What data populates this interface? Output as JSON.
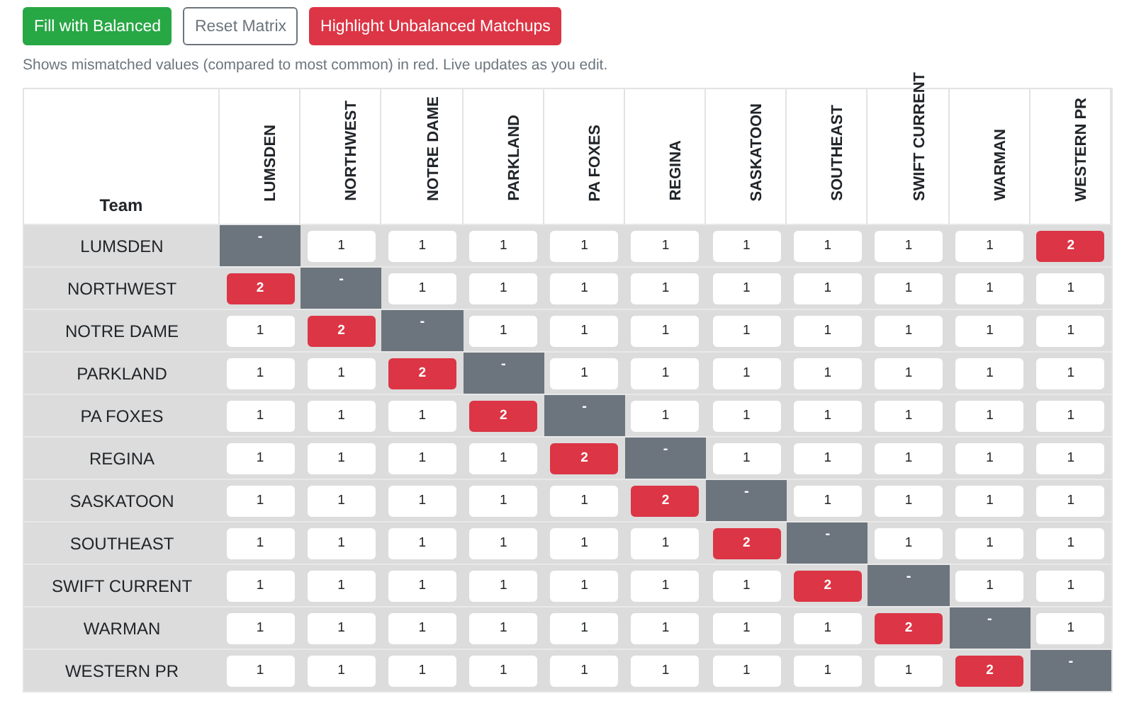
{
  "toolbar": {
    "buttons": [
      {
        "label": "Fill with Balanced",
        "kind": "success"
      },
      {
        "label": "Reset Matrix",
        "kind": "outline"
      },
      {
        "label": "Highlight Unbalanced Matchups",
        "kind": "danger"
      }
    ]
  },
  "caption": "Shows mismatched values (compared to most common) in red. Live updates as you edit.",
  "matrix": {
    "corner": "Team",
    "columns": [
      "LUMSDEN",
      "NORTHWEST",
      "NOTRE DAME",
      "PARKLAND",
      "PA FOXES",
      "REGINA",
      "SASKATOON",
      "SOUTHEAST",
      "SWIFT CURRENT",
      "WARMAN",
      "WESTERN PR"
    ],
    "rows": [
      {
        "team": "LUMSDEN",
        "cells": [
          {
            "kind": "self",
            "value": "-"
          },
          {
            "kind": "input",
            "value": "1",
            "mismatch": false
          },
          {
            "kind": "input",
            "value": "1",
            "mismatch": false
          },
          {
            "kind": "input",
            "value": "1",
            "mismatch": false
          },
          {
            "kind": "input",
            "value": "1",
            "mismatch": false
          },
          {
            "kind": "input",
            "value": "1",
            "mismatch": false
          },
          {
            "kind": "input",
            "value": "1",
            "mismatch": false
          },
          {
            "kind": "input",
            "value": "1",
            "mismatch": false
          },
          {
            "kind": "input",
            "value": "1",
            "mismatch": false
          },
          {
            "kind": "input",
            "value": "1",
            "mismatch": false
          },
          {
            "kind": "input",
            "value": "2",
            "mismatch": true
          }
        ]
      },
      {
        "team": "NORTHWEST",
        "cells": [
          {
            "kind": "input",
            "value": "2",
            "mismatch": true
          },
          {
            "kind": "self",
            "value": "-"
          },
          {
            "kind": "input",
            "value": "1",
            "mismatch": false
          },
          {
            "kind": "input",
            "value": "1",
            "mismatch": false
          },
          {
            "kind": "input",
            "value": "1",
            "mismatch": false
          },
          {
            "kind": "input",
            "value": "1",
            "mismatch": false
          },
          {
            "kind": "input",
            "value": "1",
            "mismatch": false
          },
          {
            "kind": "input",
            "value": "1",
            "mismatch": false
          },
          {
            "kind": "input",
            "value": "1",
            "mismatch": false
          },
          {
            "kind": "input",
            "value": "1",
            "mismatch": false
          },
          {
            "kind": "input",
            "value": "1",
            "mismatch": false
          }
        ]
      },
      {
        "team": "NOTRE DAME",
        "cells": [
          {
            "kind": "input",
            "value": "1",
            "mismatch": false
          },
          {
            "kind": "input",
            "value": "2",
            "mismatch": true
          },
          {
            "kind": "self",
            "value": "-"
          },
          {
            "kind": "input",
            "value": "1",
            "mismatch": false
          },
          {
            "kind": "input",
            "value": "1",
            "mismatch": false
          },
          {
            "kind": "input",
            "value": "1",
            "mismatch": false
          },
          {
            "kind": "input",
            "value": "1",
            "mismatch": false
          },
          {
            "kind": "input",
            "value": "1",
            "mismatch": false
          },
          {
            "kind": "input",
            "value": "1",
            "mismatch": false
          },
          {
            "kind": "input",
            "value": "1",
            "mismatch": false
          },
          {
            "kind": "input",
            "value": "1",
            "mismatch": false
          }
        ]
      },
      {
        "team": "PARKLAND",
        "cells": [
          {
            "kind": "input",
            "value": "1",
            "mismatch": false
          },
          {
            "kind": "input",
            "value": "1",
            "mismatch": false
          },
          {
            "kind": "input",
            "value": "2",
            "mismatch": true
          },
          {
            "kind": "self",
            "value": "-"
          },
          {
            "kind": "input",
            "value": "1",
            "mismatch": false
          },
          {
            "kind": "input",
            "value": "1",
            "mismatch": false
          },
          {
            "kind": "input",
            "value": "1",
            "mismatch": false
          },
          {
            "kind": "input",
            "value": "1",
            "mismatch": false
          },
          {
            "kind": "input",
            "value": "1",
            "mismatch": false
          },
          {
            "kind": "input",
            "value": "1",
            "mismatch": false
          },
          {
            "kind": "input",
            "value": "1",
            "mismatch": false
          }
        ]
      },
      {
        "team": "PA FOXES",
        "cells": [
          {
            "kind": "input",
            "value": "1",
            "mismatch": false
          },
          {
            "kind": "input",
            "value": "1",
            "mismatch": false
          },
          {
            "kind": "input",
            "value": "1",
            "mismatch": false
          },
          {
            "kind": "input",
            "value": "2",
            "mismatch": true
          },
          {
            "kind": "self",
            "value": "-"
          },
          {
            "kind": "input",
            "value": "1",
            "mismatch": false
          },
          {
            "kind": "input",
            "value": "1",
            "mismatch": false
          },
          {
            "kind": "input",
            "value": "1",
            "mismatch": false
          },
          {
            "kind": "input",
            "value": "1",
            "mismatch": false
          },
          {
            "kind": "input",
            "value": "1",
            "mismatch": false
          },
          {
            "kind": "input",
            "value": "1",
            "mismatch": false
          }
        ]
      },
      {
        "team": "REGINA",
        "cells": [
          {
            "kind": "input",
            "value": "1",
            "mismatch": false
          },
          {
            "kind": "input",
            "value": "1",
            "mismatch": false
          },
          {
            "kind": "input",
            "value": "1",
            "mismatch": false
          },
          {
            "kind": "input",
            "value": "1",
            "mismatch": false
          },
          {
            "kind": "input",
            "value": "2",
            "mismatch": true
          },
          {
            "kind": "self",
            "value": "-"
          },
          {
            "kind": "input",
            "value": "1",
            "mismatch": false
          },
          {
            "kind": "input",
            "value": "1",
            "mismatch": false
          },
          {
            "kind": "input",
            "value": "1",
            "mismatch": false
          },
          {
            "kind": "input",
            "value": "1",
            "mismatch": false
          },
          {
            "kind": "input",
            "value": "1",
            "mismatch": false
          }
        ]
      },
      {
        "team": "SASKATOON",
        "cells": [
          {
            "kind": "input",
            "value": "1",
            "mismatch": false
          },
          {
            "kind": "input",
            "value": "1",
            "mismatch": false
          },
          {
            "kind": "input",
            "value": "1",
            "mismatch": false
          },
          {
            "kind": "input",
            "value": "1",
            "mismatch": false
          },
          {
            "kind": "input",
            "value": "1",
            "mismatch": false
          },
          {
            "kind": "input",
            "value": "2",
            "mismatch": true
          },
          {
            "kind": "self",
            "value": "-"
          },
          {
            "kind": "input",
            "value": "1",
            "mismatch": false
          },
          {
            "kind": "input",
            "value": "1",
            "mismatch": false
          },
          {
            "kind": "input",
            "value": "1",
            "mismatch": false
          },
          {
            "kind": "input",
            "value": "1",
            "mismatch": false
          }
        ]
      },
      {
        "team": "SOUTHEAST",
        "cells": [
          {
            "kind": "input",
            "value": "1",
            "mismatch": false
          },
          {
            "kind": "input",
            "value": "1",
            "mismatch": false
          },
          {
            "kind": "input",
            "value": "1",
            "mismatch": false
          },
          {
            "kind": "input",
            "value": "1",
            "mismatch": false
          },
          {
            "kind": "input",
            "value": "1",
            "mismatch": false
          },
          {
            "kind": "input",
            "value": "1",
            "mismatch": false
          },
          {
            "kind": "input",
            "value": "2",
            "mismatch": true
          },
          {
            "kind": "self",
            "value": "-"
          },
          {
            "kind": "input",
            "value": "1",
            "mismatch": false
          },
          {
            "kind": "input",
            "value": "1",
            "mismatch": false
          },
          {
            "kind": "input",
            "value": "1",
            "mismatch": false
          }
        ]
      },
      {
        "team": "SWIFT CURRENT",
        "cells": [
          {
            "kind": "input",
            "value": "1",
            "mismatch": false
          },
          {
            "kind": "input",
            "value": "1",
            "mismatch": false
          },
          {
            "kind": "input",
            "value": "1",
            "mismatch": false
          },
          {
            "kind": "input",
            "value": "1",
            "mismatch": false
          },
          {
            "kind": "input",
            "value": "1",
            "mismatch": false
          },
          {
            "kind": "input",
            "value": "1",
            "mismatch": false
          },
          {
            "kind": "input",
            "value": "1",
            "mismatch": false
          },
          {
            "kind": "input",
            "value": "2",
            "mismatch": true
          },
          {
            "kind": "self",
            "value": "-"
          },
          {
            "kind": "input",
            "value": "1",
            "mismatch": false
          },
          {
            "kind": "input",
            "value": "1",
            "mismatch": false
          }
        ]
      },
      {
        "team": "WARMAN",
        "cells": [
          {
            "kind": "input",
            "value": "1",
            "mismatch": false
          },
          {
            "kind": "input",
            "value": "1",
            "mismatch": false
          },
          {
            "kind": "input",
            "value": "1",
            "mismatch": false
          },
          {
            "kind": "input",
            "value": "1",
            "mismatch": false
          },
          {
            "kind": "input",
            "value": "1",
            "mismatch": false
          },
          {
            "kind": "input",
            "value": "1",
            "mismatch": false
          },
          {
            "kind": "input",
            "value": "1",
            "mismatch": false
          },
          {
            "kind": "input",
            "value": "1",
            "mismatch": false
          },
          {
            "kind": "input",
            "value": "2",
            "mismatch": true
          },
          {
            "kind": "self",
            "value": "-"
          },
          {
            "kind": "input",
            "value": "1",
            "mismatch": false
          }
        ]
      },
      {
        "team": "WESTERN PR",
        "cells": [
          {
            "kind": "input",
            "value": "1",
            "mismatch": false
          },
          {
            "kind": "input",
            "value": "1",
            "mismatch": false
          },
          {
            "kind": "input",
            "value": "1",
            "mismatch": false
          },
          {
            "kind": "input",
            "value": "1",
            "mismatch": false
          },
          {
            "kind": "input",
            "value": "1",
            "mismatch": false
          },
          {
            "kind": "input",
            "value": "1",
            "mismatch": false
          },
          {
            "kind": "input",
            "value": "1",
            "mismatch": false
          },
          {
            "kind": "input",
            "value": "1",
            "mismatch": false
          },
          {
            "kind": "input",
            "value": "1",
            "mismatch": false
          },
          {
            "kind": "input",
            "value": "2",
            "mismatch": true
          },
          {
            "kind": "self",
            "value": "-"
          }
        ]
      }
    ]
  }
}
